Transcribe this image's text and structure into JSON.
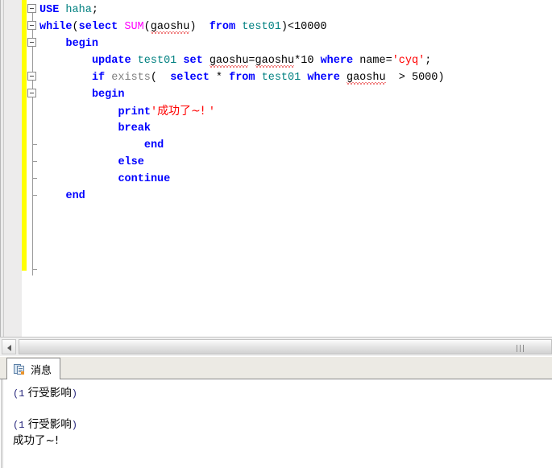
{
  "editor": {
    "name": "sql-query-editor",
    "change_bar_color": "#ffff00",
    "gutter_color": "#edecec",
    "lines": [
      {
        "n": 1,
        "fold": "box",
        "indent": 0,
        "tokens": [
          {
            "t": "USE",
            "c": "kw"
          },
          {
            "t": " ",
            "c": "blk"
          },
          {
            "t": "haha",
            "c": "tbl"
          },
          {
            "t": ";",
            "c": "blk"
          }
        ]
      },
      {
        "n": 2,
        "fold": "box",
        "indent": 0,
        "tokens": [
          {
            "t": "while",
            "c": "kw"
          },
          {
            "t": "(",
            "c": "blk"
          },
          {
            "t": "select",
            "c": "kw"
          },
          {
            "t": " ",
            "c": "blk"
          },
          {
            "t": "SUM",
            "c": "fn"
          },
          {
            "t": "(",
            "c": "blk"
          },
          {
            "t": "gaoshu",
            "c": "blk sq"
          },
          {
            "t": ")",
            "c": "blk"
          },
          {
            "t": "  ",
            "c": "blk"
          },
          {
            "t": "from",
            "c": "kw"
          },
          {
            "t": " ",
            "c": "blk"
          },
          {
            "t": "test01",
            "c": "tbl"
          },
          {
            "t": ")<10000",
            "c": "blk"
          }
        ]
      },
      {
        "n": 3,
        "fold": "box",
        "indent": 4,
        "tokens": [
          {
            "t": "begin",
            "c": "kw"
          }
        ]
      },
      {
        "n": 4,
        "fold": "none",
        "indent": 8,
        "tokens": [
          {
            "t": "update",
            "c": "kw"
          },
          {
            "t": " ",
            "c": "blk"
          },
          {
            "t": "test01",
            "c": "tbl"
          },
          {
            "t": " ",
            "c": "blk"
          },
          {
            "t": "set",
            "c": "kw"
          },
          {
            "t": " ",
            "c": "blk"
          },
          {
            "t": "gaoshu",
            "c": "blk sq"
          },
          {
            "t": "=",
            "c": "blk"
          },
          {
            "t": "gaoshu",
            "c": "blk sq"
          },
          {
            "t": "*10",
            "c": "blk"
          },
          {
            "t": " ",
            "c": "blk"
          },
          {
            "t": "where",
            "c": "kw"
          },
          {
            "t": " ",
            "c": "blk"
          },
          {
            "t": "name",
            "c": "blk"
          },
          {
            "t": "=",
            "c": "blk"
          },
          {
            "t": "'cyq'",
            "c": "str"
          },
          {
            "t": ";",
            "c": "blk"
          }
        ]
      },
      {
        "n": 5,
        "fold": "box",
        "indent": 8,
        "tokens": [
          {
            "t": "if",
            "c": "kw"
          },
          {
            "t": " ",
            "c": "blk"
          },
          {
            "t": "exists",
            "c": "gry"
          },
          {
            "t": "(  ",
            "c": "blk"
          },
          {
            "t": "select",
            "c": "kw"
          },
          {
            "t": " * ",
            "c": "blk"
          },
          {
            "t": "from",
            "c": "kw"
          },
          {
            "t": " ",
            "c": "blk"
          },
          {
            "t": "test01",
            "c": "tbl"
          },
          {
            "t": " ",
            "c": "blk"
          },
          {
            "t": "where",
            "c": "kw"
          },
          {
            "t": " ",
            "c": "blk"
          },
          {
            "t": "gaoshu",
            "c": "blk sq"
          },
          {
            "t": "  > 5000)",
            "c": "blk"
          }
        ]
      },
      {
        "n": 6,
        "fold": "box",
        "indent": 8,
        "tokens": [
          {
            "t": "begin",
            "c": "kw"
          }
        ]
      },
      {
        "n": 7,
        "fold": "none",
        "indent": 12,
        "tokens": [
          {
            "t": "print",
            "c": "kw"
          },
          {
            "t": "'",
            "c": "str"
          },
          {
            "t": "成功了~! ",
            "c": "str cn"
          },
          {
            "t": "'",
            "c": "str"
          }
        ]
      },
      {
        "n": 8,
        "fold": "none",
        "indent": 12,
        "tokens": [
          {
            "t": "break",
            "c": "kw"
          }
        ]
      },
      {
        "n": 9,
        "fold": "tick",
        "indent": 16,
        "tokens": [
          {
            "t": "end",
            "c": "kw"
          }
        ]
      },
      {
        "n": 10,
        "fold": "tick",
        "indent": 12,
        "tokens": [
          {
            "t": "else",
            "c": "kw"
          }
        ]
      },
      {
        "n": 11,
        "fold": "tick",
        "indent": 12,
        "tokens": [
          {
            "t": "continue",
            "c": "kw"
          }
        ]
      },
      {
        "n": 12,
        "fold": "tick",
        "indent": 4,
        "tokens": [
          {
            "t": "end",
            "c": "kw"
          }
        ]
      }
    ]
  },
  "hscrollbar": {
    "left_arrow_icon": "triangle-left-icon",
    "grip_icon": "scrollbar-grip-icon",
    "thumb_label": ""
  },
  "results": {
    "tabs": [
      {
        "label": "消息",
        "icon": "messages-document-icon",
        "active": true
      }
    ],
    "messages": [
      {
        "prefix": "(",
        "num": "1",
        "text": " 行受影响",
        "suffix": ")"
      },
      {
        "blank": true
      },
      {
        "prefix": "(",
        "num": "1",
        "text": " 行受影响",
        "suffix": ")"
      },
      {
        "plain": "成功了~!"
      }
    ]
  }
}
